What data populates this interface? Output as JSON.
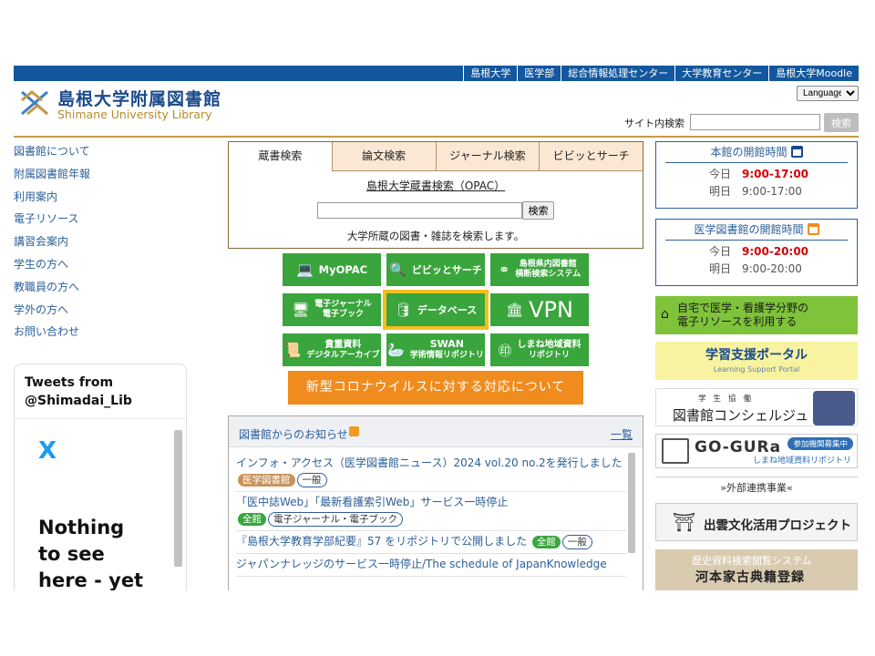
{
  "top_nav": [
    "島根大学",
    "医学部",
    "総合情報処理センター",
    "大学教育センター",
    "島根大学Moodle"
  ],
  "header": {
    "title": "島根大学附属図書館",
    "subtitle": "Shimane University Library",
    "language": "Language",
    "site_search_label": "サイト内検索",
    "site_search_button": "検索"
  },
  "left_nav": [
    "図書館について",
    "附属図書館年報",
    "利用案内",
    "電子リソース",
    "講習会案内",
    "学生の方へ",
    "教職員の方へ",
    "学外の方へ",
    "お問い合わせ"
  ],
  "twitter": {
    "heading_line1": "Tweets from",
    "heading_line2": "@Shimadai_Lib",
    "logo": "X",
    "empty_line1": "Nothing",
    "empty_line2": "to see",
    "empty_line3": "here - yet"
  },
  "search": {
    "tabs": [
      "蔵書検索",
      "論文検索",
      "ジャーナル検索",
      "ビビッとサーチ"
    ],
    "active_tab": "蔵書検索",
    "opac_link": "島根大学蔵書検索（OPAC）",
    "button": "検索",
    "description": "大学所蔵の図書・雑誌を検索します。"
  },
  "quick_links": {
    "myopac": "MyOPAC",
    "vivid": "ビビッとサーチ",
    "pref_line1": "島根県内図書館",
    "pref_line2": "横断検索システム",
    "ejournal_line1": "電子ジャーナル",
    "ejournal_line2": "電子ブック",
    "database": "データベース",
    "vpn": "VPN",
    "rare_line1": "貴重資料",
    "rare_line2": "デジタルアーカイブ",
    "swan_line1": "SWAN",
    "swan_line2": "学術情報リポジトリ",
    "local_line1": "しまね地域資料",
    "local_line2": "リポジトリ"
  },
  "corona_banner": "新型コロナウイルスに対する対応について",
  "news": {
    "title": "図書館からのお知らせ",
    "more": "一覧",
    "items": [
      {
        "text": "インフォ・アクセス（医学図書館ニュース）2024 vol.20 no.2を発行しました",
        "tag1": "医学図書館",
        "tag2": "一般"
      },
      {
        "text": "「医中誌Web」「最新看護索引Web」サービス一時停止",
        "tag1": "全館",
        "tag2": "電子ジャーナル・電子ブック"
      },
      {
        "text": "『島根大学教育学部紀要』57 をリポジトリで公開しました",
        "tag1": "全館",
        "tag2": "一般"
      },
      {
        "text": "ジャパンナレッジのサービス一時停止/The schedule of JapanKnowledge",
        "tag1": "",
        "tag2": ""
      }
    ]
  },
  "hours": {
    "main": {
      "title": "本館の開館時間",
      "today_label": "今日",
      "today": "9:00-17:00",
      "tomorrow_label": "明日",
      "tomorrow": "9:00-17:00"
    },
    "medical": {
      "title": "医学図書館の開館時間",
      "today_label": "今日",
      "today": "9:00-20:00",
      "tomorrow_label": "明日",
      "tomorrow": "9:00-20:00"
    }
  },
  "banners": {
    "remote_line1": "自宅で医学・看護学分野の",
    "remote_line2": "電子リソースを利用する",
    "portal_title": "学習支援ポータル",
    "portal_sub": "Learning Support Portal",
    "concierge_small": "学生協働",
    "concierge_big": "図書館コンシェルジュ",
    "gogura_name": "GO-GURa",
    "gogura_pill": "参加機関募集中",
    "gogura_sub": "しまね地域資料リポジトリ",
    "external_label": "»外部連携事業«",
    "izumo": "出雲文化活用プロジェクト",
    "kawamoto_small": "歴史資料検索閲覧システム",
    "kawamoto": "河本家古典籍登録"
  },
  "colors": {
    "primary": "#13579e",
    "green": "#3aa53c",
    "orange": "#f08c1e",
    "gold": "#c79a4a"
  }
}
